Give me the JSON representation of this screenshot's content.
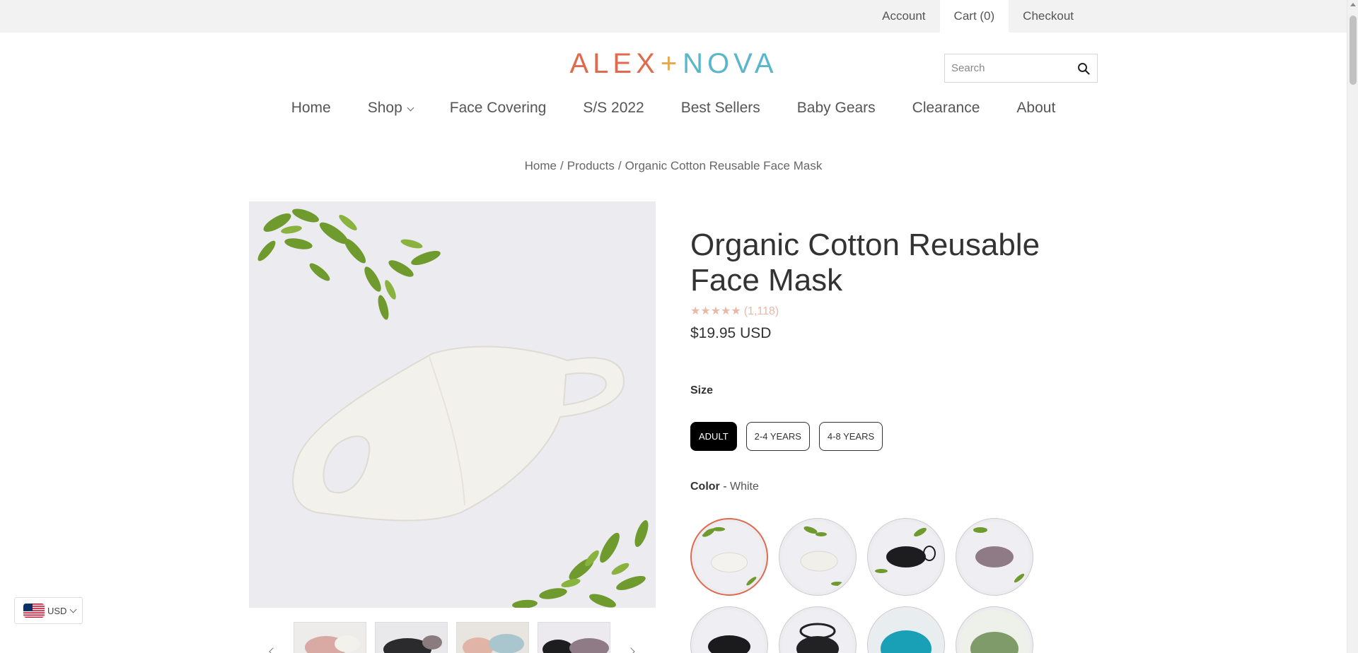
{
  "topbar": {
    "links": [
      {
        "label": "Account"
      },
      {
        "label": "Cart (0)"
      },
      {
        "label": "Checkout"
      }
    ]
  },
  "logo": {
    "part1": "ALEX",
    "plus": "+",
    "part2": "NOVA"
  },
  "search": {
    "placeholder": "Search",
    "icon": "search-icon"
  },
  "nav": {
    "items": [
      {
        "label": "Home"
      },
      {
        "label": "Shop"
      },
      {
        "label": "Face Covering"
      },
      {
        "label": "S/S 2022"
      },
      {
        "label": "Best Sellers"
      },
      {
        "label": "Baby Gears"
      },
      {
        "label": "Clearance"
      },
      {
        "label": "About"
      }
    ]
  },
  "breadcrumb": {
    "home": "Home",
    "sep": "/",
    "products": "Products",
    "current": "Organic Cotton Reusable Face Mask"
  },
  "product": {
    "title": "Organic Cotton Reusable Face Mask",
    "rating_count": "(1,118)",
    "rating_stars": 5,
    "price": "$19.95 USD",
    "size_label": "Size",
    "sizes": [
      {
        "label": "ADULT",
        "selected": true
      },
      {
        "label": "2-4 YEARS",
        "selected": false
      },
      {
        "label": "4-8 YEARS",
        "selected": false
      }
    ],
    "color_label": "Color",
    "color_sep": " - ",
    "color_value": "White",
    "swatch_colors": [
      "#f4f2ee",
      "#f1efea",
      "#1d1d1f",
      "#8f7b86",
      "#1b1b1d",
      "#222224",
      "#1aa0b6",
      "#7f9b6a"
    ]
  },
  "currency": {
    "code": "USD"
  },
  "colors": {
    "accent": "#e06a4e",
    "logo_teal": "#5ab7c9",
    "logo_plus": "#e8a84d",
    "star": "#e9b9a8"
  }
}
